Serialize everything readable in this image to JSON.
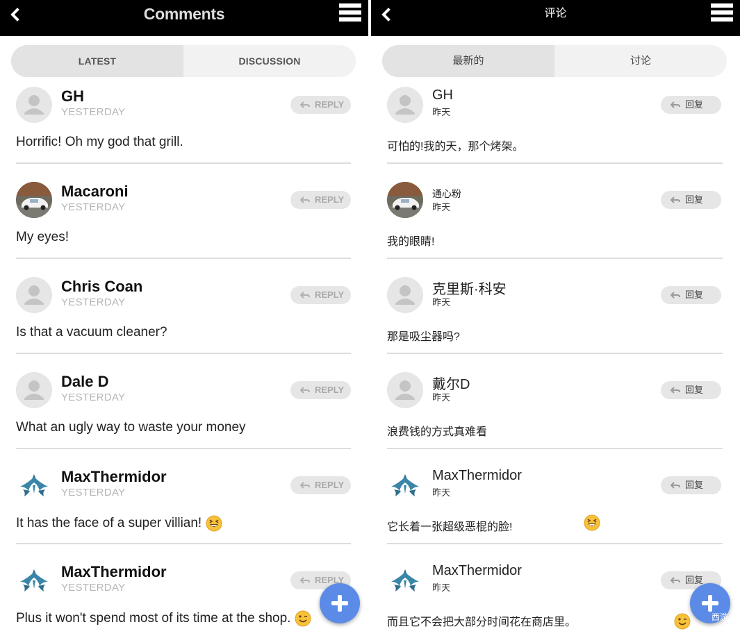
{
  "left": {
    "title": "Comments",
    "tabs": [
      {
        "label": "LATEST",
        "active": true
      },
      {
        "label": "DISCUSSION",
        "active": false
      }
    ],
    "reply_label": "REPLY",
    "comments": [
      {
        "name": "GH",
        "time": "YESTERDAY",
        "text": "Horrific! Oh my god that grill.",
        "avatar": "default"
      },
      {
        "name": "Macaroni",
        "time": "YESTERDAY",
        "text": "My eyes!",
        "avatar": "car-photo"
      },
      {
        "name": "Chris Coan",
        "time": "YESTERDAY",
        "text": "Is that a vacuum cleaner?",
        "avatar": "default"
      },
      {
        "name": "Dale D",
        "time": "YESTERDAY",
        "text": "What an ugly way to waste your money",
        "avatar": "default"
      },
      {
        "name": "MaxThermidor",
        "time": "YESTERDAY",
        "text": "It has the face of a super villian!",
        "avatar": "warframe-logo",
        "emoji": "grinning-squint-emoji"
      },
      {
        "name": "MaxThermidor",
        "time": "YESTERDAY",
        "text": "Plus it won't spend most of its time at the shop.",
        "avatar": "warframe-logo",
        "emoji": "winking-emoji"
      }
    ]
  },
  "right": {
    "title": "评论",
    "tabs": [
      {
        "label": "最新的",
        "active": true
      },
      {
        "label": "讨论",
        "active": false
      }
    ],
    "reply_label": "回复",
    "comments": [
      {
        "name": "GH",
        "time": "昨天",
        "text": "可怕的!我的天，那个烤架。",
        "avatar": "default"
      },
      {
        "name": "通心粉",
        "time": "昨天",
        "text": "我的眼睛!",
        "avatar": "car-photo"
      },
      {
        "name": "克里斯·科安",
        "time": "昨天",
        "text": "那是吸尘器吗?",
        "avatar": "default"
      },
      {
        "name": "戴尔D",
        "time": "昨天",
        "text": "浪费钱的方式真难看",
        "avatar": "default"
      },
      {
        "name": "MaxThermidor",
        "time": "昨天",
        "text": "它长着一张超级恶棍的脸!",
        "avatar": "warframe-logo",
        "emoji": "grinning-squint-emoji"
      },
      {
        "name": "MaxThermidor",
        "time": "昨天",
        "text": "而且它不会把大部分时间花在商店里。",
        "avatar": "warframe-logo",
        "emoji": "winking-emoji"
      }
    ]
  },
  "watermark": "西游",
  "colors": {
    "topbar": "#000000",
    "fab": "#5b8be6",
    "reply_bg": "#e6e6e6"
  },
  "icons": {
    "back": "chevron-left-icon",
    "menu": "hamburger-menu-icon",
    "reply": "reply-arrow-icon",
    "fab": "plus-icon"
  }
}
